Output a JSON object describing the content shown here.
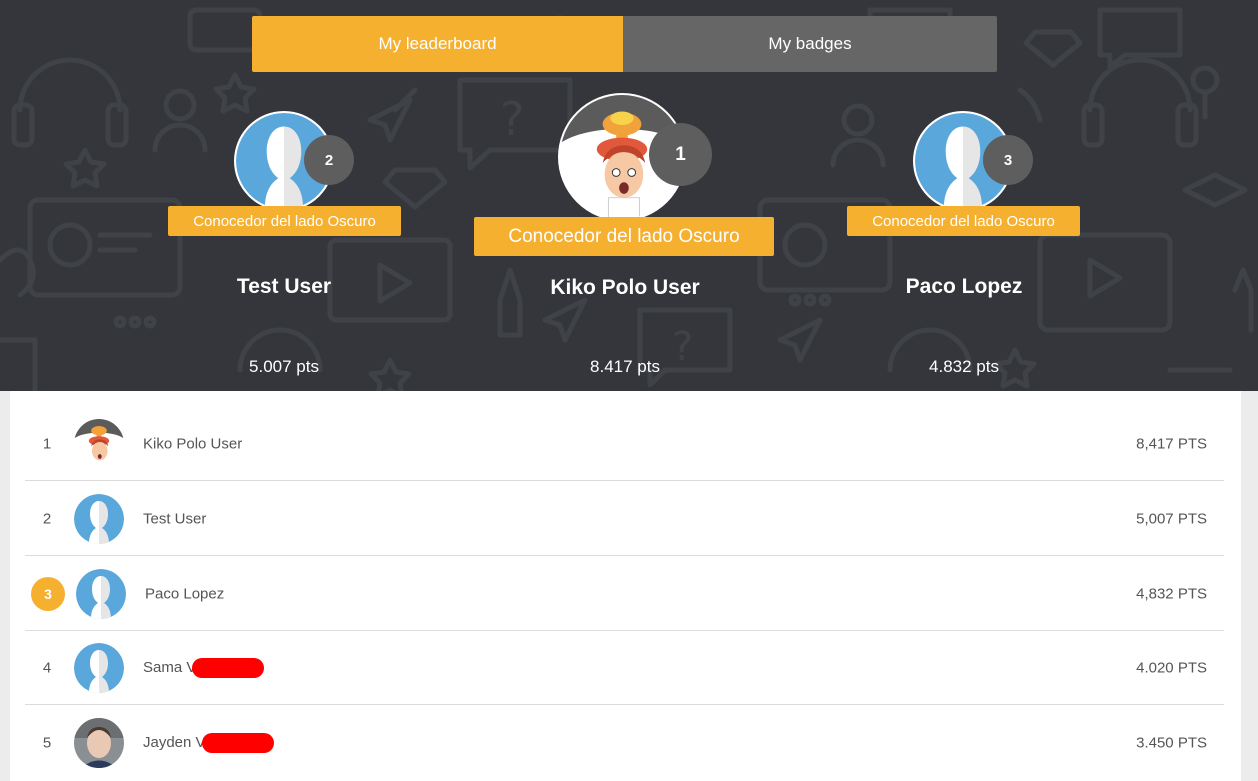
{
  "tabs": [
    {
      "label": "My leaderboard",
      "active": true
    },
    {
      "label": "My badges",
      "active": false
    }
  ],
  "podium": {
    "first": {
      "rank": "1",
      "badge": "Conocedor del lado Oscuro",
      "name": "Kiko Polo User",
      "points": "8.417 pts",
      "avatar": "cartoon-explosion-avatar"
    },
    "second": {
      "rank": "2",
      "badge": "Conocedor del lado Oscuro",
      "name": "Test User",
      "points": "5.007 pts",
      "avatar": "default-user-avatar"
    },
    "third": {
      "rank": "3",
      "badge": "Conocedor del lado Oscuro",
      "name": "Paco Lopez",
      "points": "4.832 pts",
      "avatar": "default-user-avatar"
    }
  },
  "leaderboard": [
    {
      "position": "1",
      "name": "Kiko Polo User",
      "points": "8,417 PTS",
      "avatar": "cartoon-explosion-avatar",
      "highlighted": false,
      "redacted": false
    },
    {
      "position": "2",
      "name": "Test User",
      "points": "5,007 PTS",
      "avatar": "default-user-avatar",
      "highlighted": false,
      "redacted": false
    },
    {
      "position": "3",
      "name": "Paco Lopez",
      "points": "4,832 PTS",
      "avatar": "default-user-avatar",
      "highlighted": true,
      "redacted": false
    },
    {
      "position": "4",
      "name": "Sama V",
      "points": "4.020 PTS",
      "avatar": "default-user-avatar",
      "highlighted": false,
      "redacted": true
    },
    {
      "position": "5",
      "name": "Jayden V",
      "points": "3.450 PTS",
      "avatar": "photo-avatar",
      "highlighted": false,
      "redacted": true
    }
  ],
  "colors": {
    "accent": "#f5b030",
    "header_bg": "#34363b",
    "tab_inactive": "#666666",
    "rank_circle": "#5e5e5e",
    "avatar_blue": "#5aa7dc",
    "redaction": "#ff0000"
  }
}
